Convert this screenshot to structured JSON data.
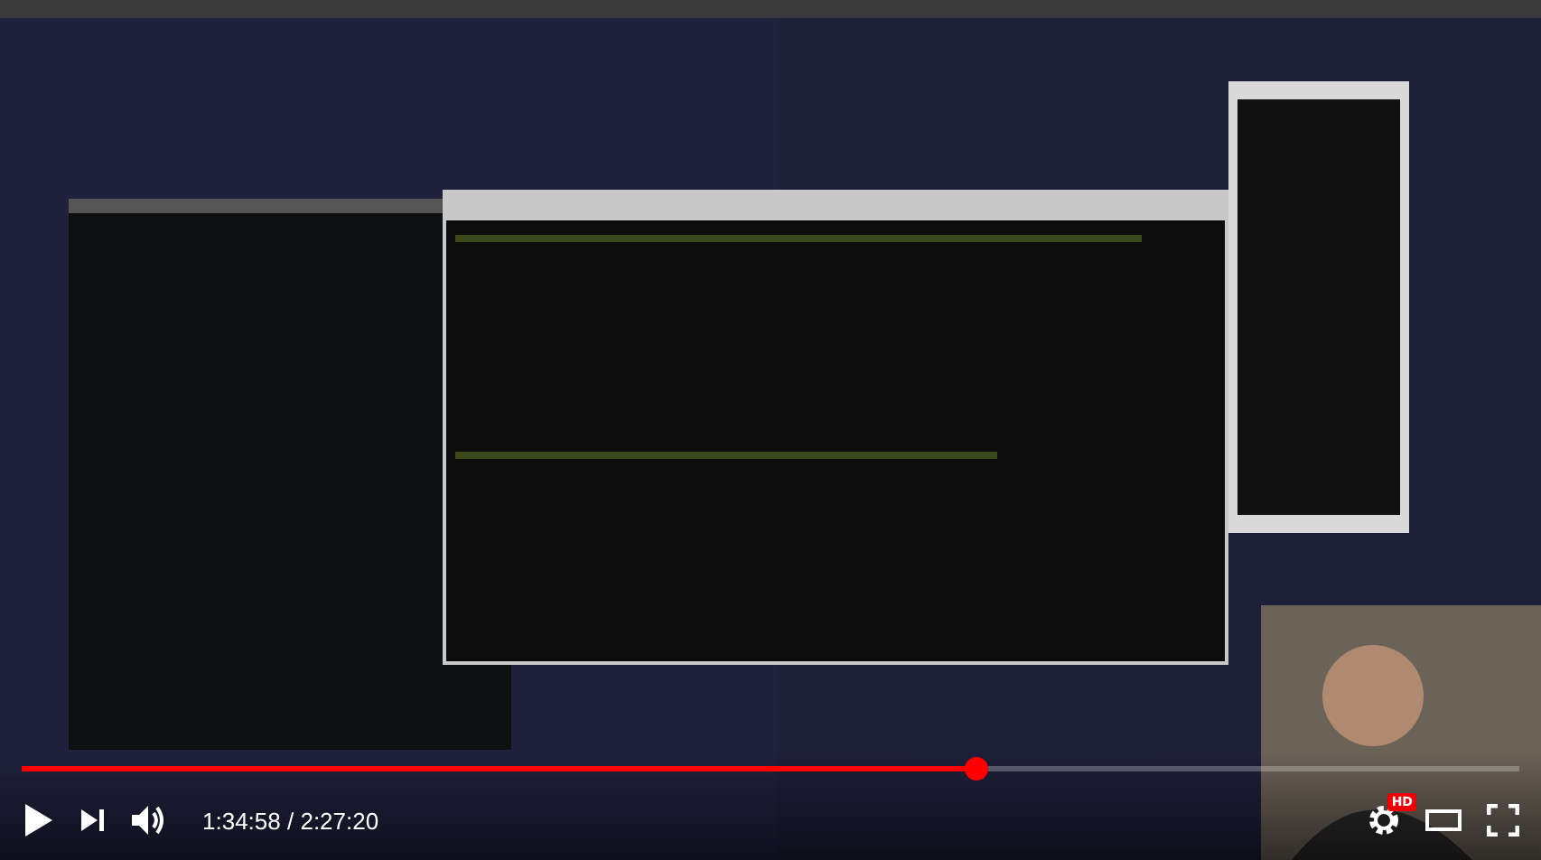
{
  "player": {
    "progress": {
      "level": 0.645
    },
    "time": "1:34:58 / 2:27:20",
    "hd_badge": "HD"
  }
}
